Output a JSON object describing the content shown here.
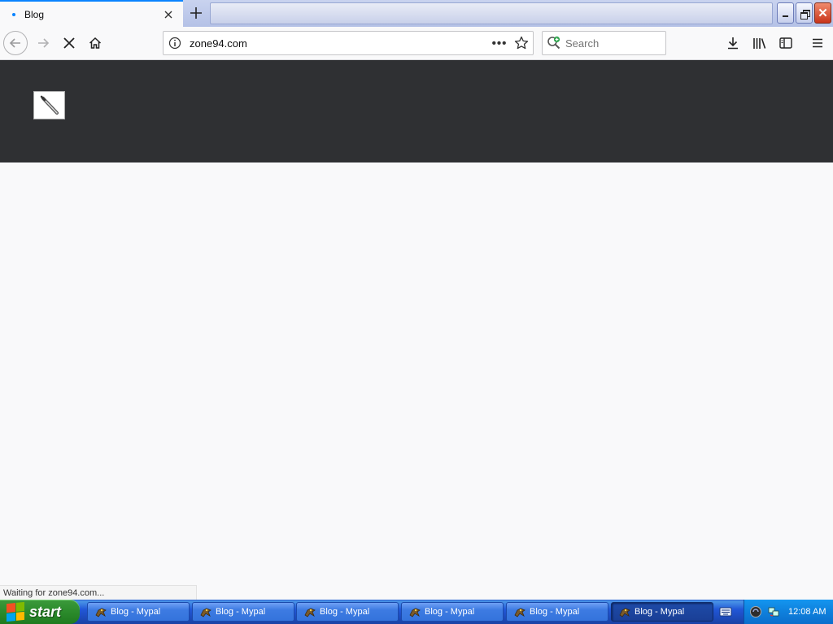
{
  "browser": {
    "tab": {
      "title": "Blog",
      "favicon": "tab-favicon-icon",
      "close_icon": "close-icon"
    },
    "new_tab_icon": "plus-icon",
    "window_controls": {
      "minimize": "minimize-icon",
      "restore": "restore-icon",
      "close": "close-icon"
    },
    "toolbar": {
      "back_icon": "arrow-left-icon",
      "forward_icon": "arrow-right-icon",
      "stop_icon": "stop-x-icon",
      "home_icon": "home-icon",
      "url": "zone94.com",
      "page_actions_label": "•••",
      "bookmark_icon": "star-icon",
      "search_placeholder": "Search",
      "downloads_icon": "download-icon",
      "library_icon": "library-icon",
      "sidebar_icon": "sidebar-icon",
      "menu_icon": "hamburger-icon"
    },
    "status_text": "Waiting for zone94.com..."
  },
  "page": {
    "header_bg": "#2f3033",
    "body_bg": "#f9f9fa",
    "logo": "broken-image-icon"
  },
  "taskbar": {
    "start_label": "start",
    "tasks": [
      {
        "label": "Blog - Mypal",
        "active": false
      },
      {
        "label": "Blog - Mypal",
        "active": false
      },
      {
        "label": "Blog - Mypal",
        "active": false
      },
      {
        "label": "Blog - Mypal",
        "active": false
      },
      {
        "label": "Blog - Mypal",
        "active": false
      },
      {
        "label": "Blog - Mypal",
        "active": true
      }
    ],
    "clock": "12:08 AM"
  },
  "colors": {
    "accent": "#0a84ff",
    "taskbar_blue": "#245edb",
    "start_green": "#2e8e2e"
  }
}
